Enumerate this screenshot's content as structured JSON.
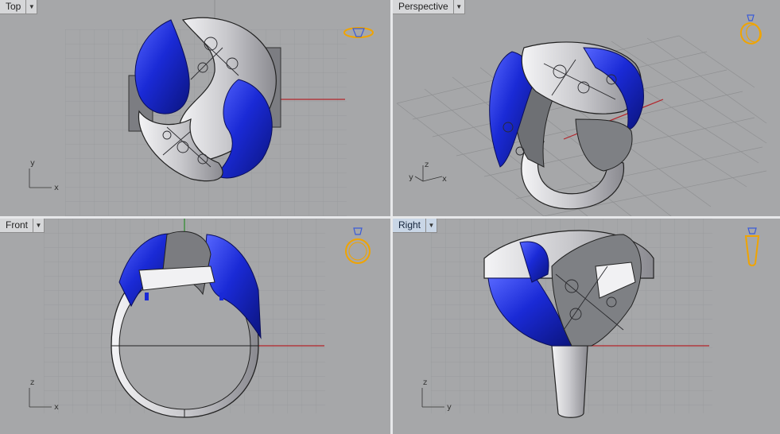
{
  "viewports": {
    "top": {
      "label": "Top",
      "axis_x": "x",
      "axis_y": "y"
    },
    "perspective": {
      "label": "Perspective",
      "axis_x": "x",
      "axis_y": "y",
      "axis_z": "z"
    },
    "front": {
      "label": "Front",
      "axis_x": "x",
      "axis_z": "z"
    },
    "right": {
      "label": "Right",
      "axis_y": "y",
      "axis_z": "z",
      "active": true
    }
  },
  "icons": {
    "dropdown": "chevron-down-icon",
    "top_gizmo": "ring-top-view-icon",
    "perspective_gizmo": "ring-perspective-icon",
    "front_gizmo": "ring-front-view-icon",
    "right_gizmo": "ring-side-view-icon"
  },
  "colors": {
    "viewport_bg": "#a6a7a9",
    "grid_line": "#9a9b9d",
    "x_axis": "#b3242a",
    "y_axis": "#2a8a2a",
    "gem_blue": "#1a2ad6",
    "metal": "#d4d4d8",
    "gizmo": "#f0a400",
    "active_label_bg": "#c9d6e6"
  }
}
